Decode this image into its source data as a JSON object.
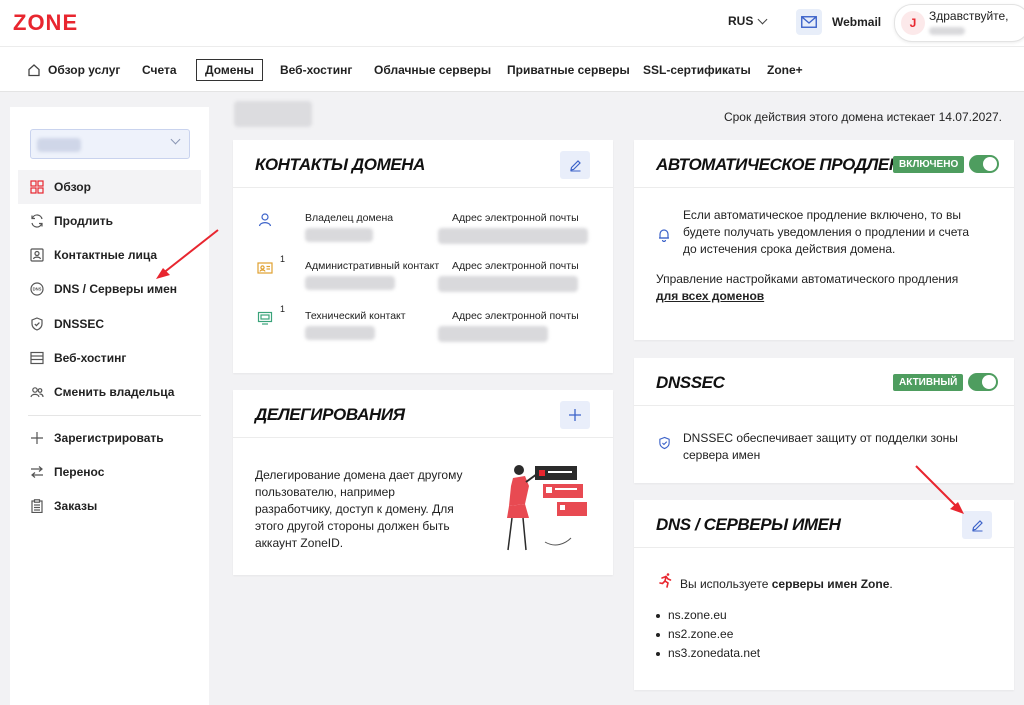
{
  "header": {
    "logo": "ZONE",
    "language": "RUS",
    "webmail": "Webmail",
    "user_initial": "J",
    "greeting": "Здравствуйте,"
  },
  "nav": {
    "items": [
      "Обзор услуг",
      "Счета",
      "Домены",
      "Веб-хостинг",
      "Облачные серверы",
      "Приватные серверы",
      "SSL-сертификаты",
      "Zone+"
    ],
    "active": "Домены"
  },
  "sidebar": {
    "items": [
      {
        "label": "Обзор",
        "icon": "grid-icon"
      },
      {
        "label": "Продлить",
        "icon": "refresh-icon"
      },
      {
        "label": "Контактные лица",
        "icon": "contact-icon"
      },
      {
        "label": "DNS / Серверы имен",
        "icon": "dns-icon"
      },
      {
        "label": "DNSSEC",
        "icon": "shield-icon"
      },
      {
        "label": "Веб-хостинг",
        "icon": "server-icon"
      },
      {
        "label": "Сменить владельца",
        "icon": "users-icon"
      }
    ],
    "secondary": [
      {
        "label": "Зарегистрировать",
        "icon": "plus-icon"
      },
      {
        "label": "Перенос",
        "icon": "transfer-icon"
      },
      {
        "label": "Заказы",
        "icon": "clipboard-icon"
      }
    ]
  },
  "main": {
    "expiry": "Срок действия этого домена истекает 14.07.2027."
  },
  "contacts": {
    "title": "Контакты домена",
    "email_label": "Адрес электронной почты",
    "rows": [
      {
        "label": "Владелец домена",
        "badge": "",
        "icon": "user-icon"
      },
      {
        "label": "Административный контакт",
        "badge": "1",
        "icon": "id-card-icon"
      },
      {
        "label": "Технический контакт",
        "badge": "1",
        "icon": "monitor-icon"
      }
    ]
  },
  "delegations": {
    "title": "Делегирования",
    "text": "Делегирование домена дает другому пользователю, например разработчику, доступ к домену. Для этого другой стороны должен быть аккаунт ZoneID."
  },
  "autorenew": {
    "title": "Автоматическое продление",
    "status": "ВКЛЮЧЕНО",
    "text": "Если автоматическое продление включено, то вы будете получать уведомления о продлении и счета до истечения срока действия домена.",
    "manage": "Управление настройками автоматического продления",
    "link": "для всех доменов"
  },
  "dnssec": {
    "title": "DNSSEC",
    "status": "АКТИВНЫЙ",
    "text": "DNSSEC обеспечивает защиту от подделки зоны сервера имен"
  },
  "dns": {
    "title": "DNS / Серверы имен",
    "using_prefix": "Вы используете",
    "using_bold": "серверы имен Zone",
    "using_suffix": ".",
    "servers": [
      "ns.zone.eu",
      "ns2.zone.ee",
      "ns3.zonedata.net"
    ]
  },
  "colors": {
    "brand": "#e8262f",
    "accent_blue": "#3d63c9",
    "success": "#4e9d5f"
  }
}
